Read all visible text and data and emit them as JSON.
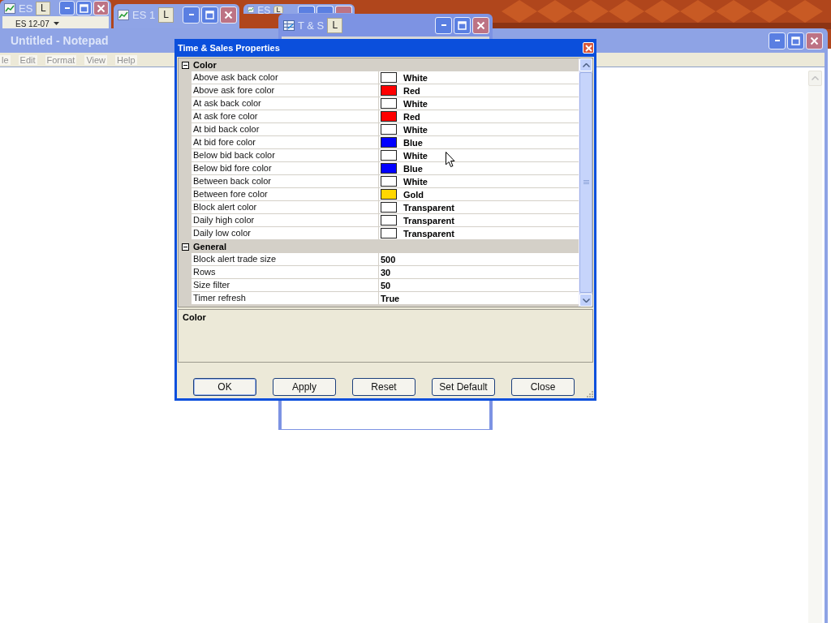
{
  "desktop_windows": [
    {
      "title": "ES",
      "badge": "L",
      "toolbar": "ES 12-07"
    },
    {
      "title": "ES 1",
      "badge": "L"
    },
    {
      "title": "ES",
      "badge": "L"
    },
    {
      "title": "T & S",
      "badge": "L"
    }
  ],
  "notepad": {
    "title": "Untitled - Notepad",
    "menu": [
      "le",
      "Edit",
      "Format",
      "View",
      "Help"
    ]
  },
  "dialog": {
    "title": "Time & Sales Properties",
    "categories": [
      {
        "name": "Color",
        "expanded": true,
        "properties": [
          {
            "name": "Above ask back color",
            "kind": "color",
            "value": "White",
            "color": "#ffffff"
          },
          {
            "name": "Above ask fore color",
            "kind": "color",
            "value": "Red",
            "color": "#ff0000"
          },
          {
            "name": "At ask back color",
            "kind": "color",
            "value": "White",
            "color": "#ffffff"
          },
          {
            "name": "At ask fore color",
            "kind": "color",
            "value": "Red",
            "color": "#ff0000"
          },
          {
            "name": "At bid back color",
            "kind": "color",
            "value": "White",
            "color": "#ffffff"
          },
          {
            "name": "At bid fore color",
            "kind": "color",
            "value": "Blue",
            "color": "#0000ff"
          },
          {
            "name": "Below bid back color",
            "kind": "color",
            "value": "White",
            "color": "#ffffff"
          },
          {
            "name": "Below bid fore color",
            "kind": "color",
            "value": "Blue",
            "color": "#0000ff"
          },
          {
            "name": "Between back color",
            "kind": "color",
            "value": "White",
            "color": "#ffffff"
          },
          {
            "name": "Between fore color",
            "kind": "color",
            "value": "Gold",
            "color": "#ffd700"
          },
          {
            "name": "Block alert color",
            "kind": "color",
            "value": "Transparent",
            "color": "#ffffff"
          },
          {
            "name": "Daily high color",
            "kind": "color",
            "value": "Transparent",
            "color": "#ffffff"
          },
          {
            "name": "Daily low color",
            "kind": "color",
            "value": "Transparent",
            "color": "#ffffff"
          }
        ]
      },
      {
        "name": "General",
        "expanded": true,
        "properties": [
          {
            "name": "Block alert trade size",
            "kind": "text",
            "value": "500"
          },
          {
            "name": "Rows",
            "kind": "text",
            "value": "30"
          },
          {
            "name": "Size filter",
            "kind": "text",
            "value": "50"
          },
          {
            "name": "Timer refresh",
            "kind": "text",
            "value": "True"
          }
        ]
      }
    ],
    "description": "Color",
    "buttons": [
      {
        "label": "OK",
        "default": true
      },
      {
        "label": "Apply",
        "default": false
      },
      {
        "label": "Reset",
        "default": false
      },
      {
        "label": "Set Default",
        "default": false
      },
      {
        "label": "Close",
        "default": false
      }
    ]
  }
}
